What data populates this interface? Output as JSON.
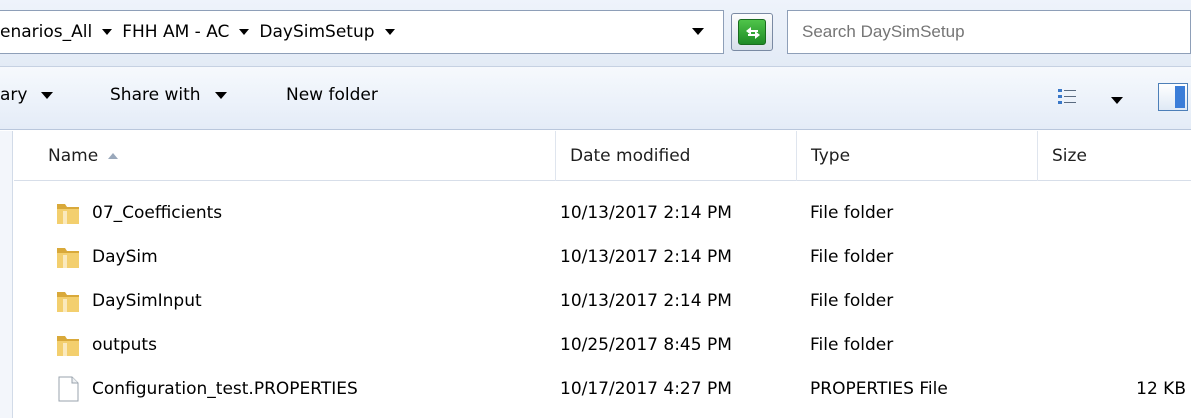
{
  "address_bar": {
    "crumbs": [
      "enarios_All",
      "FHH AM - AC",
      "DaySimSetup"
    ]
  },
  "search": {
    "placeholder": "Search DaySimSetup"
  },
  "toolbar": {
    "library_label": "ary",
    "share_label": "Share with",
    "new_folder_label": "New folder"
  },
  "columns": {
    "name": "Name",
    "date": "Date modified",
    "type": "Type",
    "size": "Size"
  },
  "files": [
    {
      "name": "07_Coefficients",
      "date": "10/13/2017 2:14 PM",
      "type": "File folder",
      "size": "",
      "icon": "folder-icon"
    },
    {
      "name": "DaySim",
      "date": "10/13/2017 2:14 PM",
      "type": "File folder",
      "size": "",
      "icon": "folder-icon"
    },
    {
      "name": "DaySimInput",
      "date": "10/13/2017 2:14 PM",
      "type": "File folder",
      "size": "",
      "icon": "folder-icon"
    },
    {
      "name": "outputs",
      "date": "10/25/2017 8:45 PM",
      "type": "File folder",
      "size": "",
      "icon": "folder-icon"
    },
    {
      "name": "Configuration_test.PROPERTIES",
      "date": "10/17/2017 4:27 PM",
      "type": "PROPERTIES File",
      "size": "12 KB",
      "icon": "document-icon"
    }
  ],
  "colors": {
    "toolbar_bg": "#e4ecf7",
    "folder": "#e8c060",
    "refresh_green": "#2fa233"
  }
}
